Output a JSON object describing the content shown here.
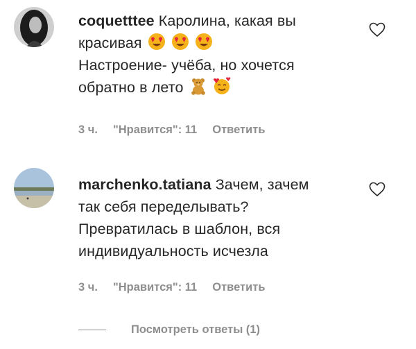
{
  "comments": [
    {
      "username": "coquetttee",
      "lines": [
        "Каролина, какая вы",
        "красивая",
        "Настроение- учёба, но хочется",
        "обратно в лето"
      ],
      "emoji_line2": [
        "heart-eyes-emoji",
        "heart-eyes-emoji",
        "heart-eyes-emoji"
      ],
      "emoji_line4": [
        "teddy-bear-emoji",
        "smiling-face-with-hearts-emoji"
      ],
      "time": "3 ч.",
      "likes": "\"Нравится\": 11",
      "reply": "Ответить"
    },
    {
      "username": "marchenko.tatiana",
      "lines": [
        "Зачем, зачем",
        "так себя переделывать?",
        "Превратилась в шаблон, вся",
        "индивидуальность исчезла"
      ],
      "time": "3 ч.",
      "likes": "\"Нравится\": 11",
      "reply": "Ответить"
    }
  ],
  "view_replies": "Посмотреть ответы (1)",
  "colors": {
    "text": "#262626",
    "secondary": "#8e8e8e",
    "emoji_face": "#f5b21b",
    "emoji_heart": "#e0243a"
  }
}
